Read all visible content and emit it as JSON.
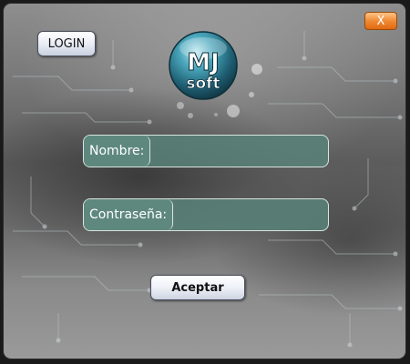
{
  "window": {
    "close_label": "X",
    "login_label": "LOGIN"
  },
  "logo": {
    "top_text": "MJ",
    "bottom_text": "soft",
    "color": "#3a8fa3"
  },
  "form": {
    "username_label": "Nombre:",
    "username_value": "",
    "password_label": "Contraseña:",
    "password_value": "",
    "submit_label": "Aceptar"
  },
  "colors": {
    "field_fill": "#5a847a",
    "close_accent": "#f08a34"
  }
}
